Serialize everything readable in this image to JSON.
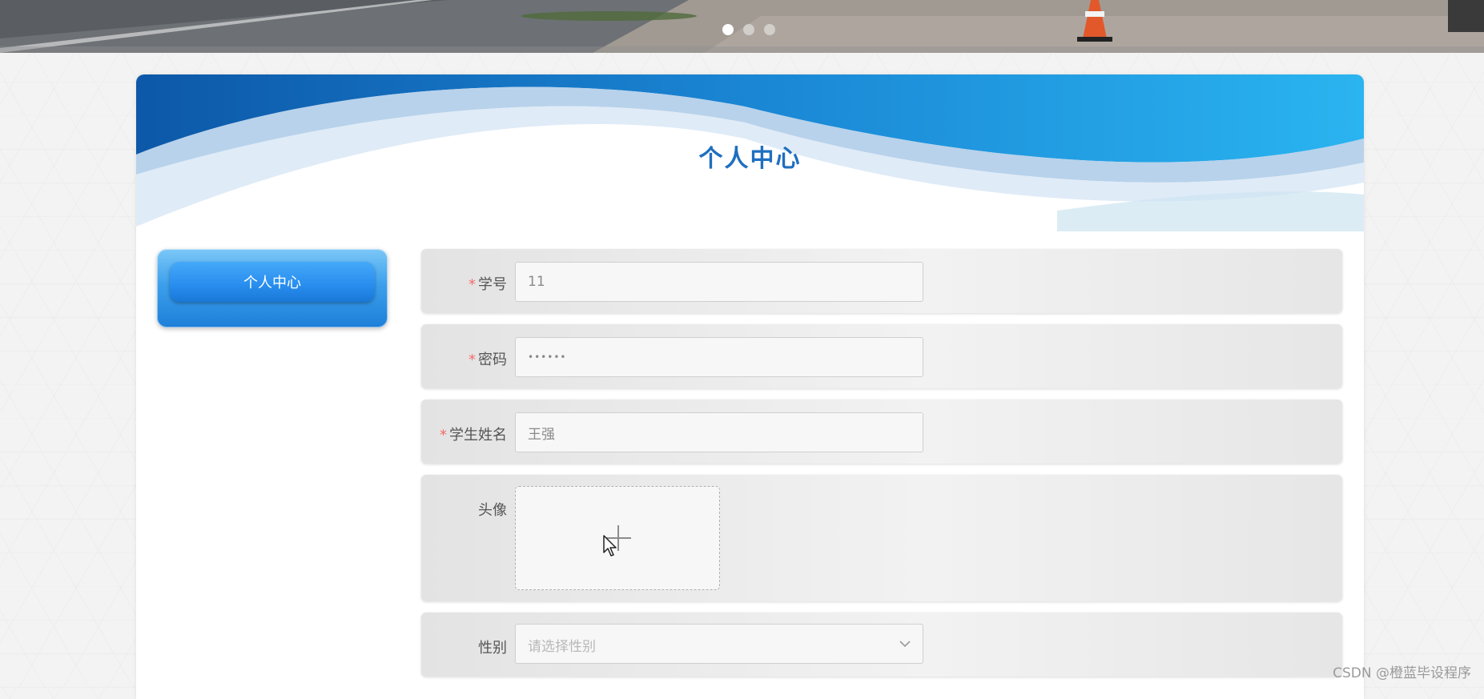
{
  "banner": {
    "carousel_dots": 3,
    "active_dot": 1
  },
  "header": {
    "title": "个人中心"
  },
  "sidebar": {
    "items": [
      {
        "label": "个人中心",
        "active": true
      }
    ]
  },
  "form": {
    "student_id": {
      "label": "学号",
      "required": true,
      "value": "11"
    },
    "password": {
      "label": "密码",
      "required": true,
      "value": "••••••"
    },
    "student_name": {
      "label": "学生姓名",
      "required": true,
      "value": "王强"
    },
    "avatar": {
      "label": "头像",
      "required": false,
      "icon": "plus-icon"
    },
    "gender": {
      "label": "性别",
      "required": false,
      "placeholder": "请选择性别",
      "icon": "chevron-down-icon"
    }
  },
  "watermark": "CSDN @橙蓝毕设程序",
  "colors": {
    "accent": "#1f6fc0",
    "required_mark": "#f56c6c",
    "menu_blue": "#2a8fef"
  }
}
